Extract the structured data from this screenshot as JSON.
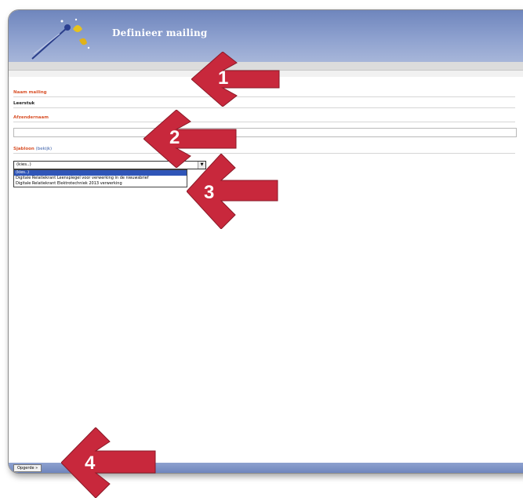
{
  "window": {
    "title": "Definieer mailing"
  },
  "form": {
    "naam_label": "Naam mailing",
    "naam_value": "Leerstuk",
    "afzender_label": "Afzendernaam",
    "afzender_value": "",
    "sjabloon_label": "Sjabloon",
    "sjabloon_link": "(bekijk)",
    "select_value": "(kies..)",
    "dropdown_options": [
      "(kies..)",
      "Digitale Relatiekrant Leenspiegel voor verwerking in de nieuwsbrief",
      "Digitale Relatiekrant Elektrotechniek 2013 verwerking"
    ]
  },
  "footer": {
    "button_label": "Opgerde »"
  },
  "callouts": [
    "1",
    "2",
    "3",
    "4"
  ],
  "colors": {
    "header": "#7a8fc4",
    "label": "#d9532b",
    "arrow": "#c8283c",
    "selected": "#2f55b8"
  }
}
